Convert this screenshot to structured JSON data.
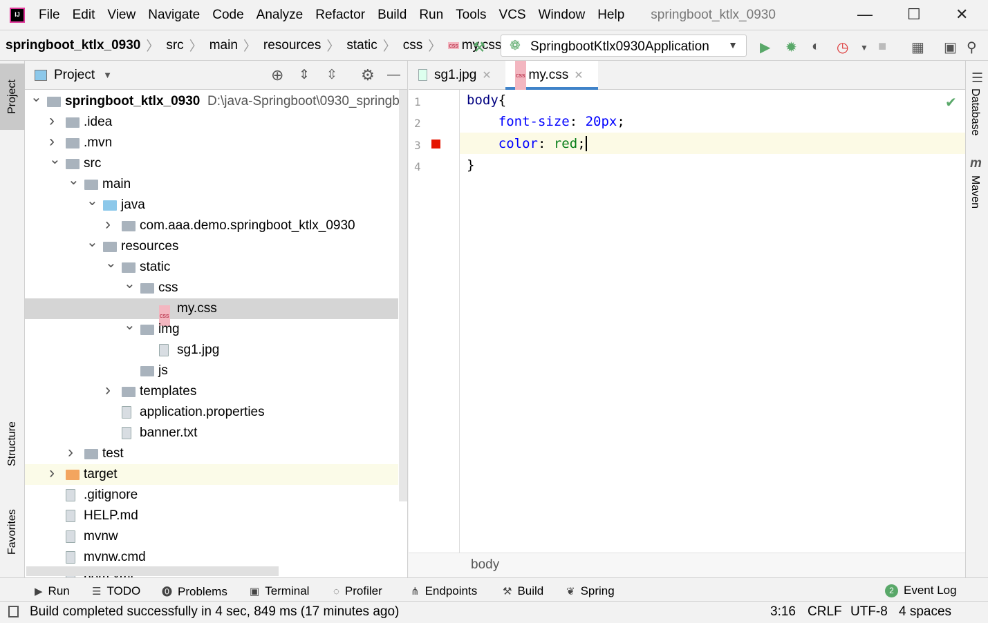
{
  "menubar": {
    "items": [
      "File",
      "Edit",
      "View",
      "Navigate",
      "Code",
      "Analyze",
      "Refactor",
      "Build",
      "Run",
      "Tools",
      "VCS",
      "Window",
      "Help"
    ],
    "window_title": "springboot_ktlx_0930"
  },
  "navbar": {
    "crumbs": [
      "springboot_ktlx_0930",
      "src",
      "main",
      "resources",
      "static",
      "css",
      "my.css"
    ],
    "run_config": "SpringbootKtlx0930Application"
  },
  "left_tools": {
    "project": "Project",
    "structure": "Structure",
    "favorites": "Favorites"
  },
  "right_tools": {
    "database": "Database",
    "maven": "Maven"
  },
  "project_panel": {
    "title": "Project",
    "tree": [
      {
        "label": "springboot_ktlx_0930",
        "path": "D:\\java-Springboot\\0930_springb",
        "level": 0,
        "expanded": true,
        "icon": "module-folder",
        "bold": true
      },
      {
        "label": ".idea",
        "level": 1,
        "expanded": false,
        "icon": "folder"
      },
      {
        "label": ".mvn",
        "level": 1,
        "expanded": false,
        "icon": "folder"
      },
      {
        "label": "src",
        "level": 1,
        "expanded": true,
        "icon": "folder"
      },
      {
        "label": "main",
        "level": 2,
        "expanded": true,
        "icon": "folder"
      },
      {
        "label": "java",
        "level": 3,
        "expanded": true,
        "icon": "source-folder"
      },
      {
        "label": "com.aaa.demo.springboot_ktlx_0930",
        "level": 4,
        "expanded": false,
        "icon": "package"
      },
      {
        "label": "resources",
        "level": 3,
        "expanded": true,
        "icon": "resources-folder"
      },
      {
        "label": "static",
        "level": 4,
        "expanded": true,
        "icon": "folder"
      },
      {
        "label": "css",
        "level": 5,
        "expanded": true,
        "icon": "folder"
      },
      {
        "label": "my.css",
        "level": 6,
        "icon": "css-file",
        "selected": true
      },
      {
        "label": "img",
        "level": 5,
        "expanded": true,
        "icon": "folder"
      },
      {
        "label": "sg1.jpg",
        "level": 6,
        "icon": "image-file"
      },
      {
        "label": "js",
        "level": 5,
        "icon": "folder"
      },
      {
        "label": "templates",
        "level": 4,
        "expanded": false,
        "icon": "folder"
      },
      {
        "label": "application.properties",
        "level": 4,
        "icon": "spring-properties-file"
      },
      {
        "label": "banner.txt",
        "level": 4,
        "icon": "text-file"
      },
      {
        "label": "test",
        "level": 2,
        "expanded": false,
        "icon": "folder"
      },
      {
        "label": "target",
        "level": 1,
        "expanded": false,
        "icon": "excluded-folder",
        "highlight": true
      },
      {
        "label": ".gitignore",
        "level": 1,
        "icon": "ignore-file"
      },
      {
        "label": "HELP.md",
        "level": 1,
        "icon": "markdown-file"
      },
      {
        "label": "mvnw",
        "level": 1,
        "icon": "script-file"
      },
      {
        "label": "mvnw.cmd",
        "level": 1,
        "icon": "text-file"
      },
      {
        "label": "pom.xml",
        "level": 1,
        "icon": "maven-file"
      }
    ]
  },
  "editor": {
    "tabs": [
      {
        "label": "sg1.jpg",
        "active": false
      },
      {
        "label": "my.css",
        "active": true
      }
    ],
    "lines": [
      "1",
      "2",
      "3",
      "4"
    ],
    "code": {
      "l1a": "body",
      "l1b": "{",
      "l2a": "font-size",
      "l2b": ": ",
      "l2c": "20px",
      "l2d": ";",
      "l3a": "color",
      "l3b": ": ",
      "l3c": "red",
      "l3d": ";",
      "l4": "}"
    },
    "breadcrumb": "body"
  },
  "bottom_tools": [
    "Run",
    "TODO",
    "Problems",
    "Terminal",
    "Profiler",
    "Endpoints",
    "Build",
    "Spring"
  ],
  "event_log": {
    "label": "Event Log",
    "count": "2"
  },
  "status": {
    "message": "Build completed successfully in 4 sec, 849 ms (17 minutes ago)",
    "position": "3:16",
    "line_sep": "CRLF",
    "encoding": "UTF-8",
    "indent": "4 spaces"
  },
  "colors": {
    "accent": "#4083c9",
    "selection": "#d5d5d5",
    "run": "#59a869",
    "error": "#e51400"
  }
}
